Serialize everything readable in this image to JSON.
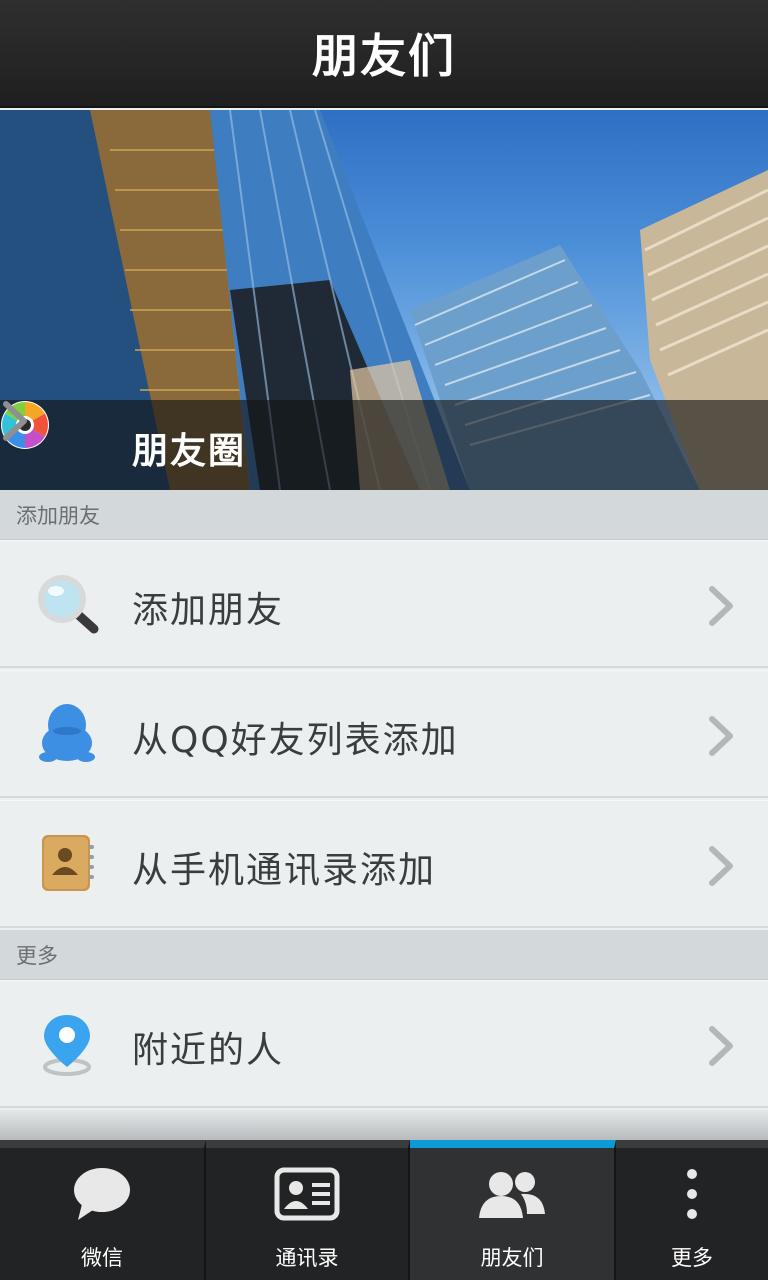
{
  "header": {
    "title": "朋友们"
  },
  "hero": {
    "moments_label": "朋友圈",
    "moments_icon": "color-aperture-icon"
  },
  "sections": [
    {
      "header": "添加朋友",
      "items": [
        {
          "label": "添加朋友",
          "icon": "magnifier-icon"
        },
        {
          "label": "从QQ好友列表添加",
          "icon": "qq-penguin-icon"
        },
        {
          "label": "从手机通讯录添加",
          "icon": "address-book-icon"
        }
      ]
    },
    {
      "header": "更多",
      "items": [
        {
          "label": "附近的人",
          "icon": "location-pin-icon"
        }
      ]
    }
  ],
  "tabs": [
    {
      "label": "微信",
      "icon": "chat-bubble-icon",
      "active": false
    },
    {
      "label": "通讯录",
      "icon": "contact-card-icon",
      "active": false
    },
    {
      "label": "朋友们",
      "icon": "people-icon",
      "active": true
    },
    {
      "label": "更多",
      "icon": "more-vertical-icon",
      "active": false
    }
  ],
  "colors": {
    "accent": "#0d9bd8",
    "titlebar": "#2a2a2a",
    "section_header": "#d3d8da",
    "row_bg": "#ebeff0"
  }
}
